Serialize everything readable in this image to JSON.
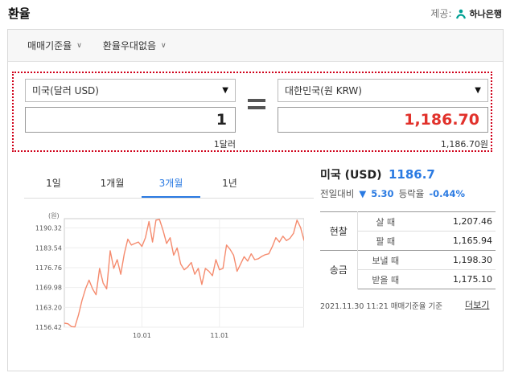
{
  "header": {
    "title": "환율",
    "provider_label": "제공:",
    "provider_name": "하나은행"
  },
  "options": {
    "rate_basis": "매매기준율",
    "preferential": "환율우대없음"
  },
  "converter": {
    "from_currency": "미국(달러 USD)",
    "from_amount": "1",
    "from_caption": "1달러",
    "to_currency": "대한민국(원 KRW)",
    "to_amount": "1,186.70",
    "to_caption": "1,186.70원",
    "to_color": "#e1312b"
  },
  "tabs": [
    {
      "label": "1일",
      "active": false
    },
    {
      "label": "1개월",
      "active": false
    },
    {
      "label": "3개월",
      "active": true
    },
    {
      "label": "1년",
      "active": false
    }
  ],
  "chart_data": {
    "type": "line",
    "unit_label": "(원)",
    "ylim": [
      1156.42,
      1193.5
    ],
    "yticks": [
      1190.32,
      1183.54,
      1176.76,
      1169.98,
      1163.2,
      1156.42
    ],
    "ytick_labels": [
      "1190.32",
      "1183.54",
      "1176.76",
      "1169.98",
      "1163.20",
      "1156.42"
    ],
    "xtick_labels": [
      "10.01",
      "11.01"
    ],
    "xtick_index": [
      22,
      44
    ],
    "line_color": "#f58b6e",
    "values": [
      1157.8,
      1157.6,
      1156.6,
      1156.5,
      1160.5,
      1165.5,
      1169.5,
      1172.5,
      1169.5,
      1167.5,
      1176.5,
      1171.5,
      1169.5,
      1182.5,
      1176.5,
      1179.5,
      1174.5,
      1181.5,
      1186.5,
      1184.5,
      1185.0,
      1185.5,
      1184.0,
      1187.0,
      1192.5,
      1185.5,
      1193.0,
      1193.2,
      1189.5,
      1185.0,
      1187.0,
      1181.0,
      1183.5,
      1178.0,
      1176.0,
      1177.0,
      1178.5,
      1174.5,
      1176.5,
      1171.0,
      1176.5,
      1175.5,
      1174.0,
      1179.5,
      1176.0,
      1176.5,
      1184.5,
      1183.0,
      1181.0,
      1175.5,
      1178.0,
      1180.5,
      1179.0,
      1181.5,
      1179.5,
      1179.8,
      1180.6,
      1181.2,
      1181.5,
      1184.0,
      1187.0,
      1185.5,
      1187.5,
      1186.0,
      1186.8,
      1188.5,
      1193.0,
      1190.5,
      1186.0
    ]
  },
  "rate": {
    "currency": "미국 (USD)",
    "value": "1186.7",
    "change_label": "전일대비",
    "change_arrow": "▼",
    "change_value": "5.30",
    "change_rate_label": "등락율",
    "change_rate": "-0.44%"
  },
  "rate_table": {
    "cash_label": "현찰",
    "transfer_label": "송금",
    "cash_buy_label": "살 때",
    "cash_buy": "1,207.46",
    "cash_sell_label": "팔 때",
    "cash_sell": "1,165.94",
    "send_label": "보낼 때",
    "send": "1,198.30",
    "receive_label": "받을 때",
    "receive": "1,175.10"
  },
  "footer": {
    "timestamp": "2021.11.30 11:21 매매기준율 기준",
    "more": "더보기"
  }
}
